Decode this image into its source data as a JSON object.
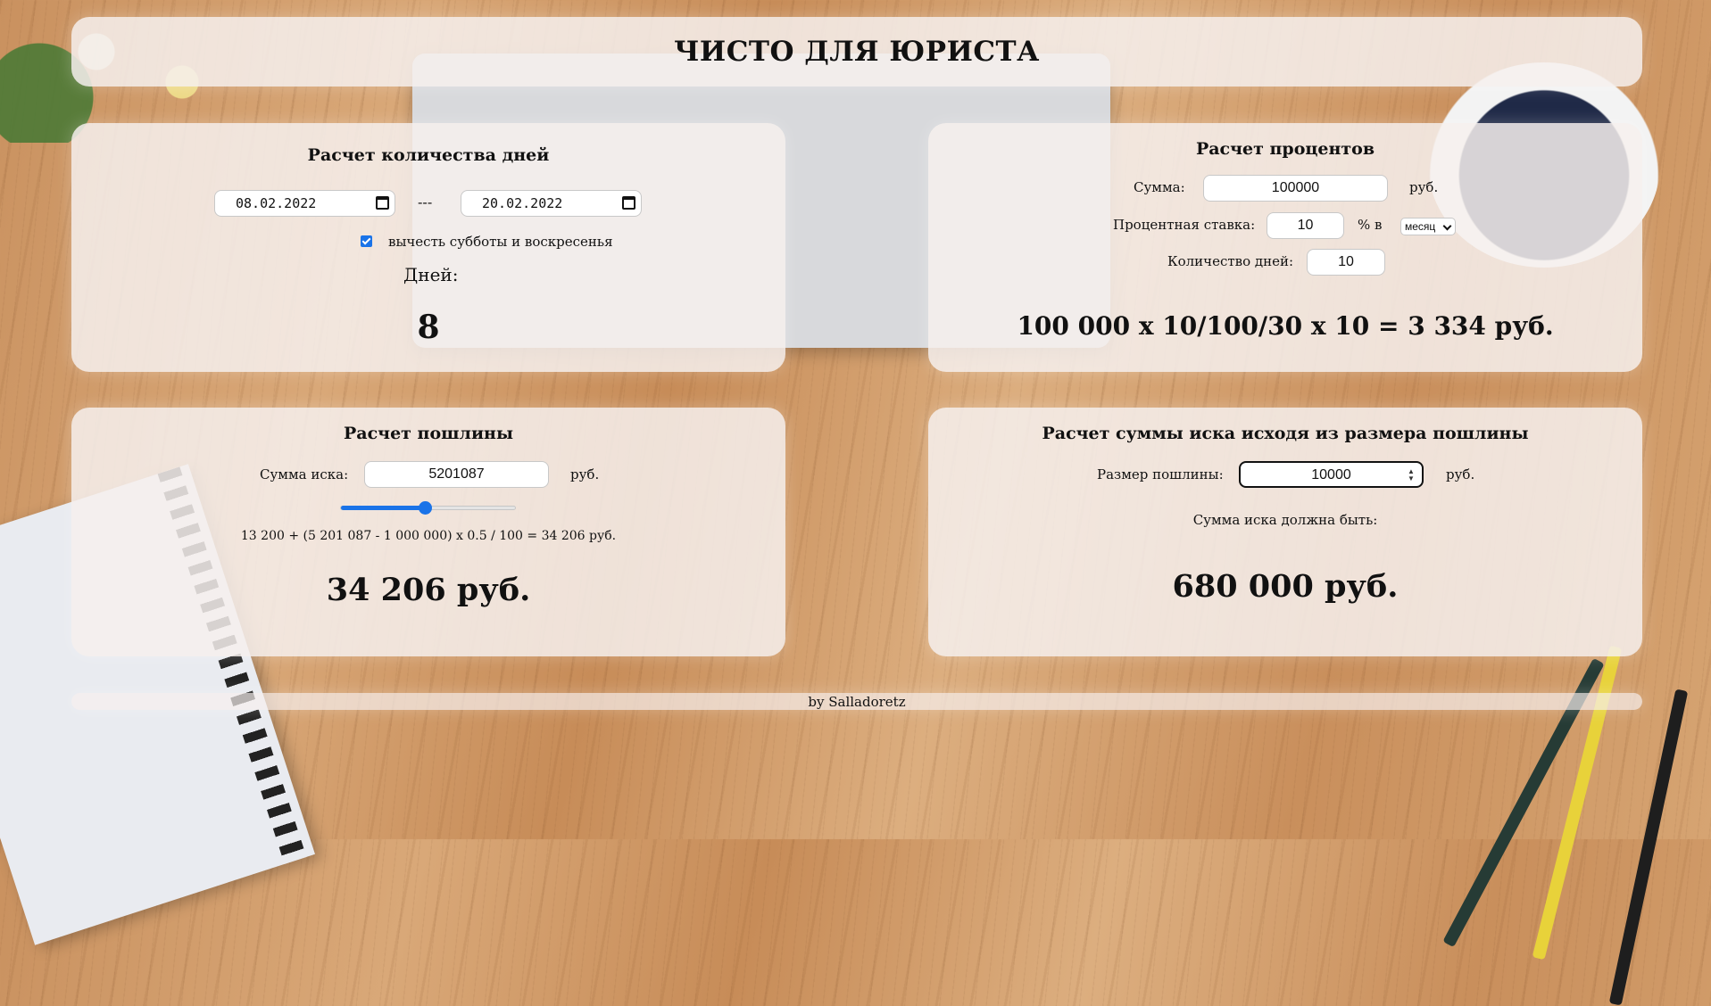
{
  "header": {
    "title": "ЧИСТО ДЛЯ ЮРИСТА"
  },
  "days_calc": {
    "title": "Расчет количества дней",
    "date_from": "08.02.2022",
    "separator": "---",
    "date_to": "20.02.2022",
    "exclude_weekends_checked": true,
    "exclude_weekends_label": "вычесть субботы и воскресенья",
    "result_label": "Дней:",
    "result_value": "8"
  },
  "percent_calc": {
    "title": "Расчет процентов",
    "sum_label": "Сумма:",
    "sum_value": "100000",
    "sum_unit": "руб.",
    "rate_label": "Процентная ставка:",
    "rate_value": "10",
    "rate_unit": "% в",
    "period_selected": "месяц",
    "days_label": "Количество дней:",
    "days_value": "10",
    "result": "100 000 x 10/100/30 x 10 = 3 334 руб."
  },
  "fee_calc": {
    "title": "Расчет пошлины",
    "claim_label": "Сумма иска:",
    "claim_value": "5201087",
    "claim_unit": "руб.",
    "slider_level": 0.48,
    "formula": "13 200 + (5 201 087 - 1 000 000) x 0.5 / 100 = 34 206 руб.",
    "result": "34 206 руб."
  },
  "claim_calc": {
    "title": "Расчет суммы иска исходя из размера пошлины",
    "fee_label": "Размер пошлины:",
    "fee_value": "10000",
    "fee_unit": "руб.",
    "result_label": "Сумма иска должна быть:",
    "result": "680 000 руб."
  },
  "footer": {
    "credit": "by Salladoretz"
  },
  "colors": {
    "accent": "#1a73e8",
    "panel": "#f6f0ee"
  }
}
